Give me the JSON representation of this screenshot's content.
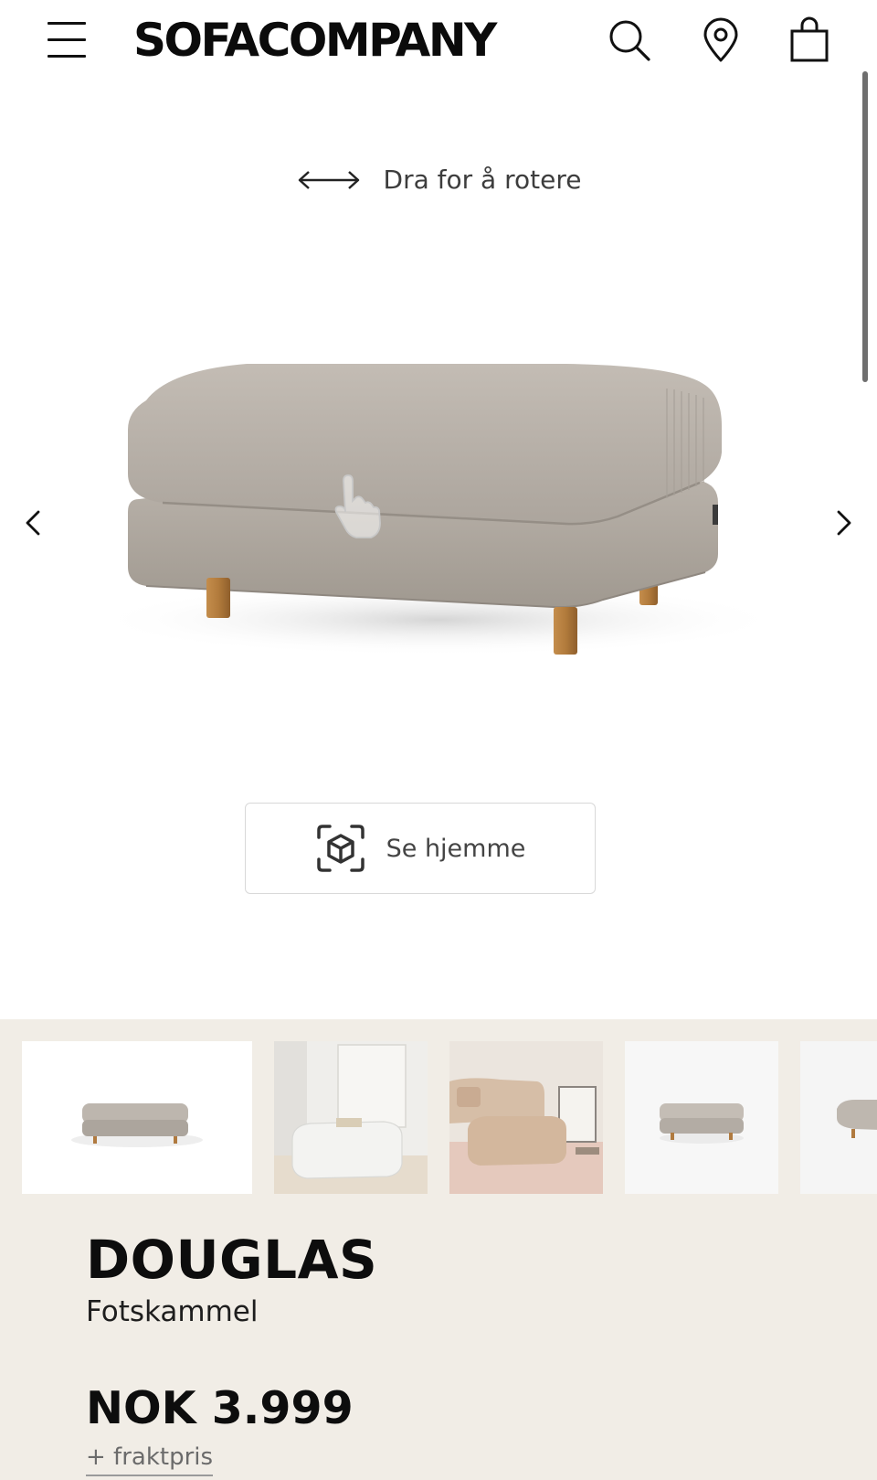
{
  "header": {
    "logo": "SOFACOMPANY",
    "icons": [
      "menu-icon",
      "search-icon",
      "location-pin-icon",
      "shopping-bag-icon"
    ]
  },
  "viewer": {
    "rotate_hint": "Dra for å rotere",
    "ar_button_label": "Se hjemme",
    "fabric_color": "#bcb5ad",
    "leg_color": "#b07a3f"
  },
  "product": {
    "name": "DOUGLAS",
    "type": "Fotskammel",
    "price": "NOK 3.999",
    "shipping_note": "+ fraktpris"
  },
  "colors": {
    "panel_background": "#f1ede6",
    "text_primary": "#0d0d0d"
  }
}
